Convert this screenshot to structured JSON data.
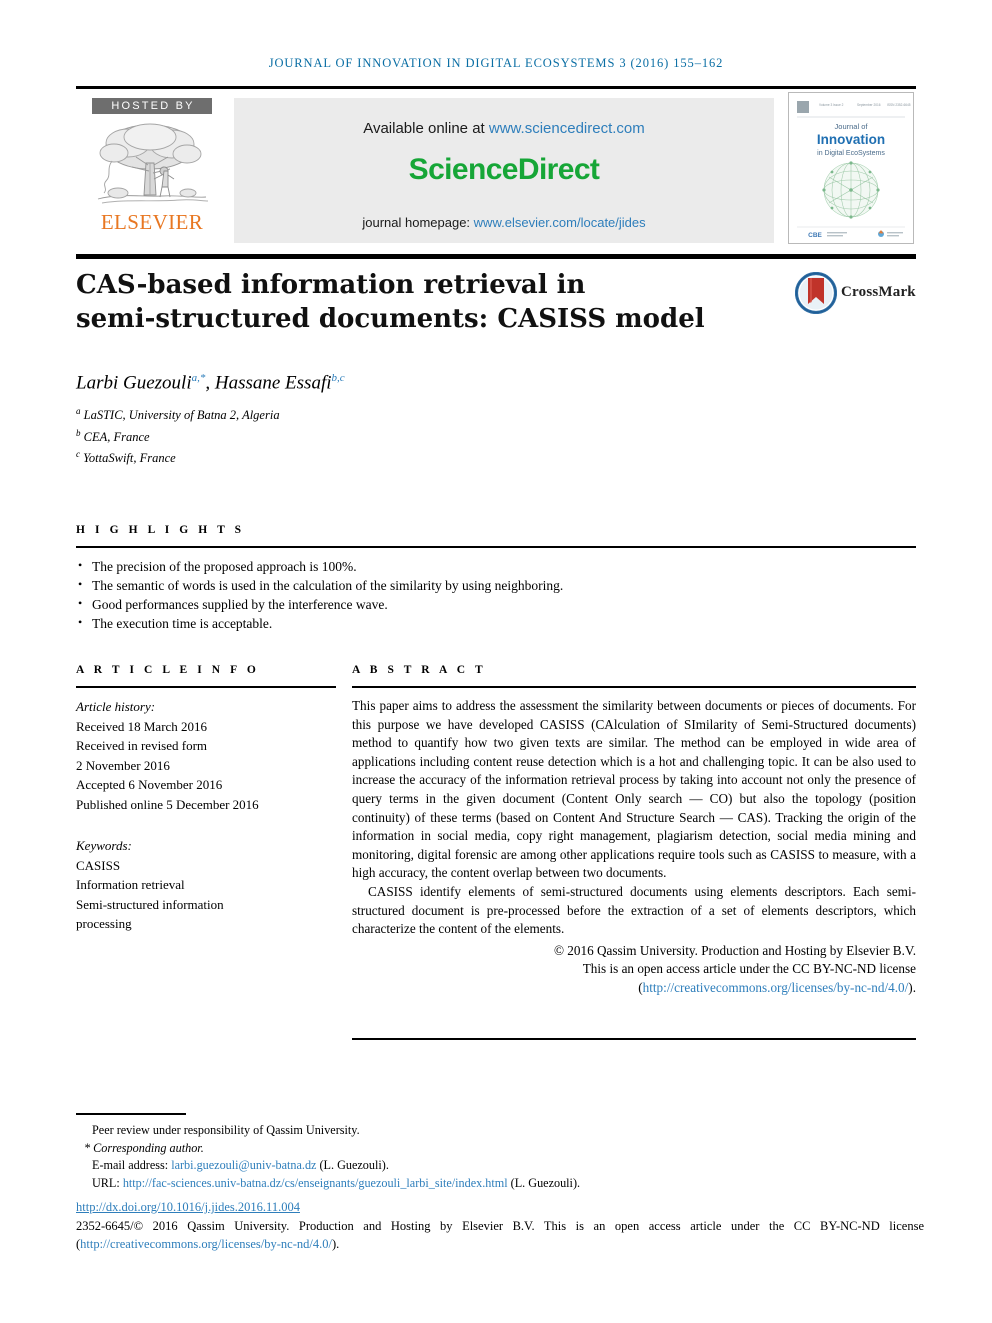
{
  "running_head": "JOURNAL OF INNOVATION IN DIGITAL ECOSYSTEMS 3 (2016) 155–162",
  "masthead": {
    "hosted_by": "HOSTED BY",
    "publisher": "ELSEVIER",
    "available_prefix": "Available online at ",
    "sciencedirect_url": "www.sciencedirect.com",
    "sciencedirect_logo": "ScienceDirect",
    "homepage_prefix": "journal homepage: ",
    "homepage_url": "www.elsevier.com/locate/jides",
    "cover": {
      "line1": "Journal of",
      "line2": "Innovation",
      "line3": "in Digital EcoSystems",
      "footer_left": "CBE",
      "issue_info": "Volume 3  Issue 2   September 2016          ISSN 2352-6645"
    }
  },
  "article": {
    "title_line1": "CAS-based information retrieval in",
    "title_line2": "semi-structured documents: CASISS model",
    "crossmark_label": "CrossMark",
    "authors_html": "Larbi Guezouli<sup>a,*</sup>, Hassane Essafi<sup>b,c</sup>",
    "affiliations": [
      {
        "marker": "a",
        "text": "LaSTIC, University of Batna 2, Algeria"
      },
      {
        "marker": "b",
        "text": "CEA, France"
      },
      {
        "marker": "c",
        "text": "YottaSwift, France"
      }
    ]
  },
  "highlights": {
    "heading": "H I G H L I G H T S",
    "items": [
      "The precision of the proposed approach is 100%.",
      "The semantic of words is used in the calculation of the similarity by using neighboring.",
      "Good performances supplied by the interference wave.",
      "The execution time is acceptable."
    ]
  },
  "article_info": {
    "heading": "A R T I C L E   I N F O",
    "history_label": "Article history:",
    "history": [
      "Received 18 March 2016",
      "Received in revised form",
      "2 November 2016",
      "Accepted 6 November 2016",
      "Published online 5 December 2016"
    ],
    "keywords_label": "Keywords:",
    "keywords": [
      "CASISS",
      "Information retrieval",
      "Semi-structured information",
      "processing"
    ]
  },
  "abstract": {
    "heading": "A B S T R A C T",
    "paragraph1": "This paper aims to address the assessment the similarity between documents or pieces of documents. For this purpose we have developed CASISS (CAlculation of SImilarity of Semi-Structured documents) method to quantify how two given texts are similar. The method can be employed in wide area of applications including content reuse detection which is a hot and challenging topic. It can be also used to increase the accuracy of the information retrieval process by taking into account not only the presence of query terms in the given document (Content Only search — CO) but also the topology (position continuity) of these terms (based on Content And Structure Search — CAS). Tracking the origin of the information in social media, copy right management, plagiarism detection, social media mining and monitoring, digital forensic are among other applications require tools such as CASISS to measure, with a high accuracy, the content overlap between two documents.",
    "paragraph2": "CASISS identify elements of semi-structured documents using elements descriptors. Each semi-structured document is pre-processed before the extraction of a set of elements descriptors, which characterize the content of the elements.",
    "copyright_line1": "© 2016 Qassim University. Production and Hosting by Elsevier B.V.",
    "copyright_line2": "This is an open access article under the CC BY-NC-ND license",
    "copyright_link_open": "(",
    "copyright_link": "http://creativecommons.org/licenses/by-nc-nd/4.0/",
    "copyright_link_close": ")."
  },
  "footer": {
    "peer_review": "Peer review under responsibility of Qassim University.",
    "corresponding": "* Corresponding author.",
    "email_label": "E-mail address: ",
    "email": "larbi.guezouli@univ-batna.dz",
    "email_suffix": " (L. Guezouli).",
    "url_label": "URL: ",
    "url": "http://fac-sciences.univ-batna.dz/cs/enseignants/guezouli_larbi_site/index.html",
    "url_suffix": " (L. Guezouli).",
    "doi": "http://dx.doi.org/10.1016/j.jides.2016.11.004",
    "license_prefix": "2352-6645/© 2016 Qassim University. Production and Hosting by Elsevier B.V. This is an open access article under the CC BY-NC-ND license (",
    "license_link": "http://creativecommons.org/licenses/by-nc-nd/4.0/",
    "license_suffix": ")."
  },
  "colors": {
    "running_head": "#0a6ea4",
    "link": "#2e7ebb",
    "sciencedirect_green": "#16a637",
    "elsevier_orange": "#E87722",
    "hosted_by_gray": "#6e6e6e"
  }
}
